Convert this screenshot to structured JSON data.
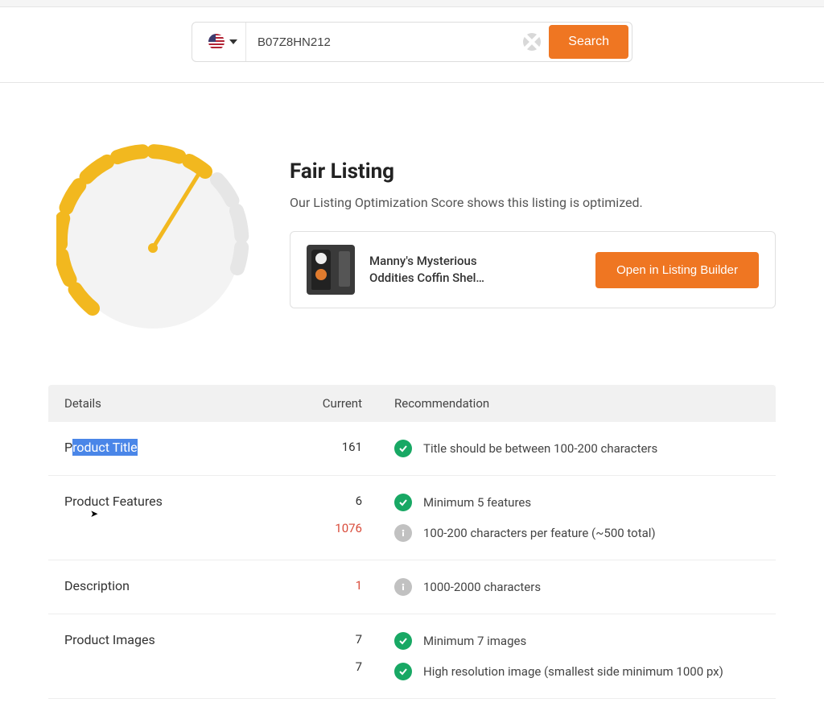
{
  "search": {
    "value": "B07Z8HN212",
    "button_label": "Search",
    "locale": "US"
  },
  "hero": {
    "title": "Fair Listing",
    "subtitle": "Our Listing Optimization Score shows this listing is optimized."
  },
  "product": {
    "name": "Manny's Mysterious Oddities Coffin Shel…",
    "open_builder_label": "Open in Listing Builder"
  },
  "table": {
    "headers": {
      "details": "Details",
      "current": "Current",
      "recommendation": "Recommendation"
    },
    "rows": [
      {
        "label_prefix": "P",
        "label_highlighted": "roduct Title",
        "values": [
          {
            "text": "161",
            "warn": false
          }
        ],
        "recs": [
          {
            "status": "ok",
            "text": "Title should be between 100-200 characters"
          }
        ]
      },
      {
        "label": "Product Features",
        "values": [
          {
            "text": "6",
            "warn": false
          },
          {
            "text": "1076",
            "warn": true
          }
        ],
        "recs": [
          {
            "status": "ok",
            "text": "Minimum 5 features"
          },
          {
            "status": "info",
            "text": "100-200 characters per feature (~500 total)"
          }
        ]
      },
      {
        "label": "Description",
        "values": [
          {
            "text": "1",
            "warn": true
          }
        ],
        "recs": [
          {
            "status": "info",
            "text": "1000-2000 characters"
          }
        ]
      },
      {
        "label": "Product Images",
        "values": [
          {
            "text": "7",
            "warn": false
          },
          {
            "text": "7",
            "warn": false
          }
        ],
        "recs": [
          {
            "status": "ok",
            "text": "Minimum 7 images"
          },
          {
            "status": "ok",
            "text": "High resolution image (smallest side minimum 1000 px)"
          }
        ]
      }
    ]
  },
  "chart_data": {
    "type": "gauge",
    "title": "Fair Listing",
    "value_percent_estimate": 65,
    "range": [
      0,
      100
    ],
    "arc_color_active": "#f2b81f",
    "arc_color_inactive": "#e6e6e6"
  }
}
